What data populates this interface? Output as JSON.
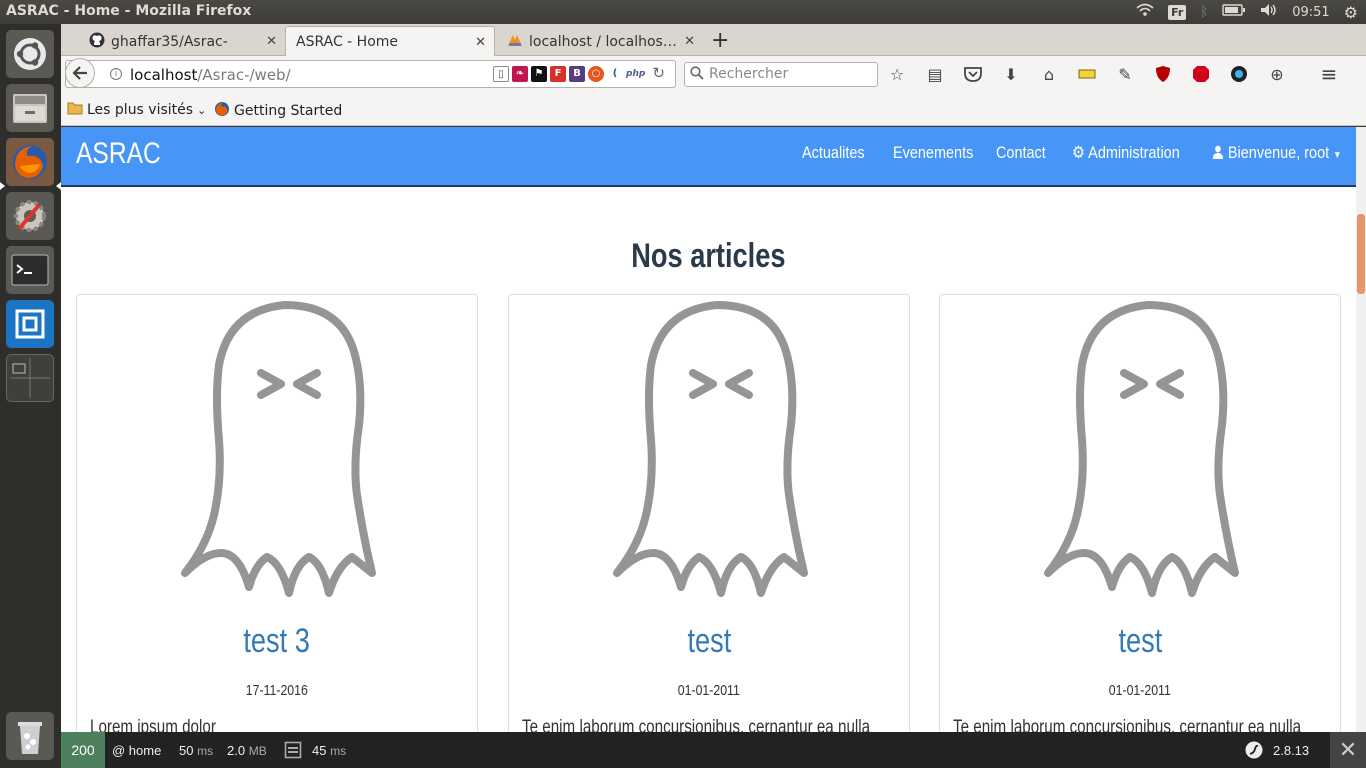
{
  "os": {
    "window_title": "ASRAC - Home - Mozilla Firefox",
    "keyboard_layout": "Fr",
    "clock": "09:51"
  },
  "launcher": {
    "items": [
      "ubuntu-dash",
      "files",
      "firefox",
      "system-settings",
      "terminal",
      "brackets",
      "workspace-switcher",
      "trash"
    ]
  },
  "browser": {
    "tabs": [
      {
        "label": "ghaffar35/Asrac-",
        "icon": "github-icon",
        "active": false
      },
      {
        "label": "ASRAC - Home",
        "icon": "",
        "active": true
      },
      {
        "label": "localhost / localhos…",
        "icon": "phpmyadmin-icon",
        "active": false
      }
    ],
    "url_host": "localhost",
    "url_path": "/Asrac-/web/",
    "search_placeholder": "Rechercher",
    "bookmarks": [
      {
        "label": "Les plus visités",
        "icon": "folder-icon"
      },
      {
        "label": "Getting Started",
        "icon": "firefox-icon"
      }
    ],
    "extension_icons": [
      "reader",
      "extension-leaf",
      "flag",
      "firebug",
      "bootstrap",
      "ubuntu",
      "jquery",
      "php"
    ]
  },
  "site": {
    "brand": "ASRAC",
    "nav": {
      "actualites": "Actualites",
      "evenements": "Evenements",
      "contact": "Contact",
      "administration": "Administration",
      "user": "Bienvenue, root"
    },
    "section_title": "Nos articles",
    "articles": [
      {
        "title": "test 3",
        "date": "17-11-2016",
        "excerpt": "Lorem ipsum dolor"
      },
      {
        "title": "test",
        "date": "01-01-2011",
        "excerpt": "Te enim laborum concursionibus, cernantur ea nulla"
      },
      {
        "title": "test",
        "date": "01-01-2011",
        "excerpt": "Te enim laborum concursionibus, cernantur ea nulla"
      }
    ]
  },
  "symfony_toolbar": {
    "status": "200",
    "route": "@ home",
    "time_value": "50",
    "time_unit": "ms",
    "memory_value": "2.0",
    "memory_unit": "MB",
    "db_time_value": "45",
    "db_time_unit": "ms",
    "version": "2.8.13"
  },
  "colors": {
    "navbar": "#4695f7",
    "link": "#337ab7",
    "status_ok": "#4f805d"
  }
}
